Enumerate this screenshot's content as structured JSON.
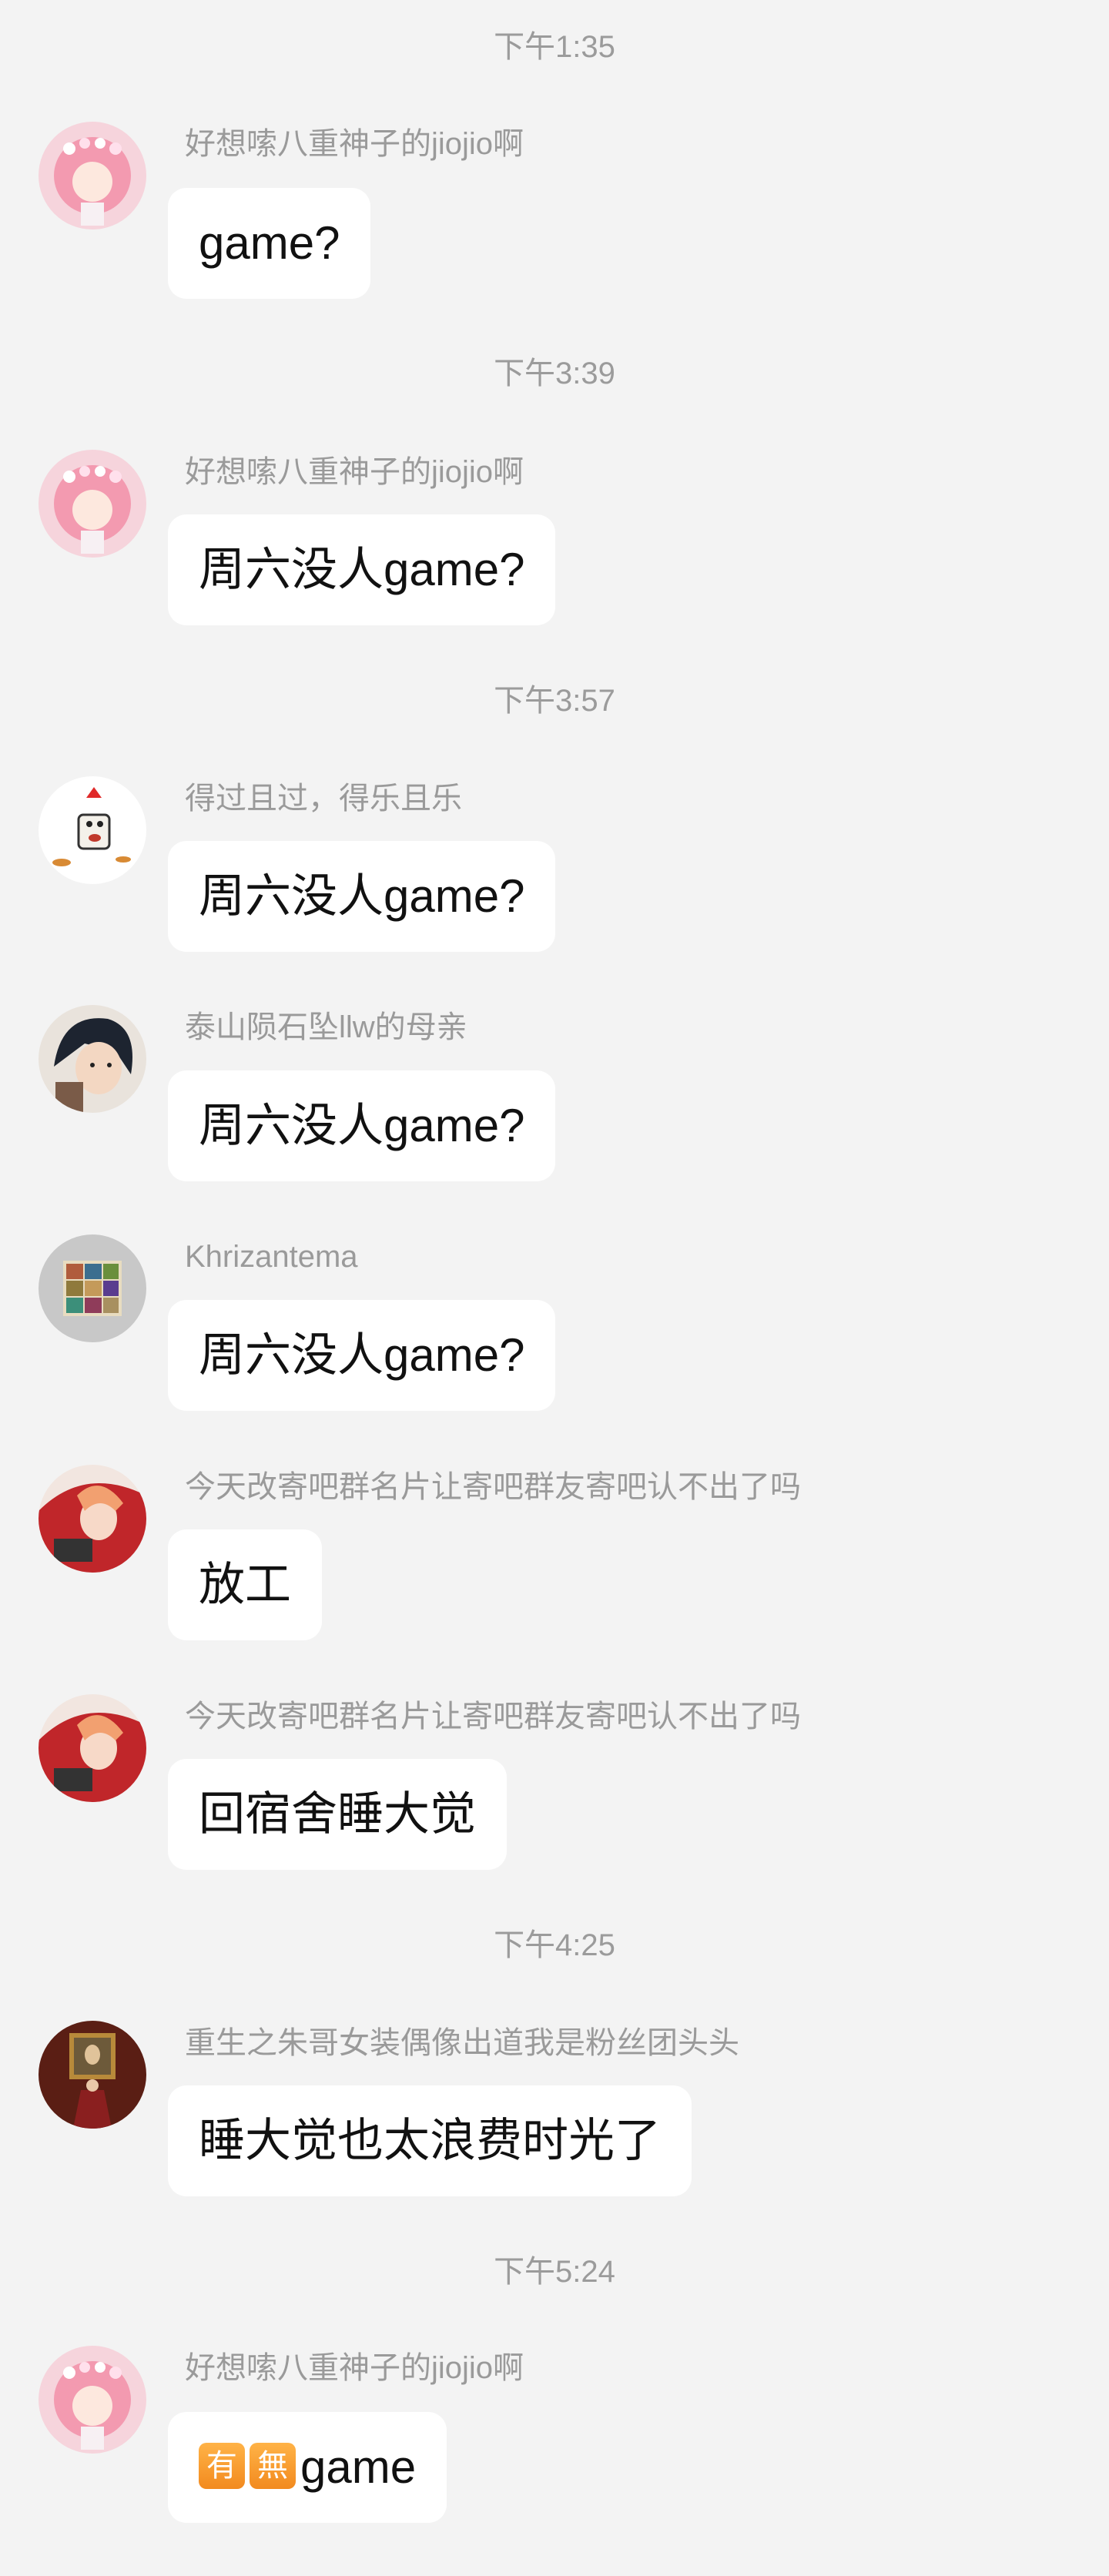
{
  "messages": [
    {
      "type": "time",
      "text": "下午1:35"
    },
    {
      "type": "msg",
      "sender": "好想嗦八重神子的jiojio啊",
      "avatar": "pink-hair-avatar",
      "text": "game?"
    },
    {
      "type": "time",
      "text": "下午3:39"
    },
    {
      "type": "msg",
      "sender": "好想嗦八重神子的jiojio啊",
      "avatar": "pink-hair-avatar",
      "text": "周六没人game?"
    },
    {
      "type": "time",
      "text": "下午3:57"
    },
    {
      "type": "msg",
      "sender": "得过且过，得乐且乐",
      "avatar": "cartoon-chicken-avatar",
      "text": "周六没人game?"
    },
    {
      "type": "msg",
      "sender": "泰山陨石坠llw的母亲",
      "avatar": "anime-boy-avatar",
      "text": "周六没人game?"
    },
    {
      "type": "msg",
      "sender": "Khrizantema",
      "avatar": "sticker-grid-avatar",
      "text": "周六没人game?"
    },
    {
      "type": "msg",
      "sender": "今天改寄吧群名片让寄吧群友寄吧认不出了吗",
      "avatar": "red-anime-avatar",
      "text": "放工"
    },
    {
      "type": "msg",
      "sender": "今天改寄吧群名片让寄吧群友寄吧认不出了吗",
      "avatar": "red-anime-avatar",
      "text": "回宿舍睡大觉"
    },
    {
      "type": "time",
      "text": "下午4:25"
    },
    {
      "type": "msg",
      "sender": "重生之朱哥女装偶像出道我是粉丝团头头",
      "avatar": "painting-avatar",
      "text": "睡大觉也太浪费时光了"
    },
    {
      "type": "time",
      "text": "下午5:24"
    },
    {
      "type": "msg",
      "sender": "好想嗦八重神子的jiojio啊",
      "avatar": "pink-hair-avatar",
      "emoji": [
        "有",
        "無"
      ],
      "text": "game"
    }
  ]
}
